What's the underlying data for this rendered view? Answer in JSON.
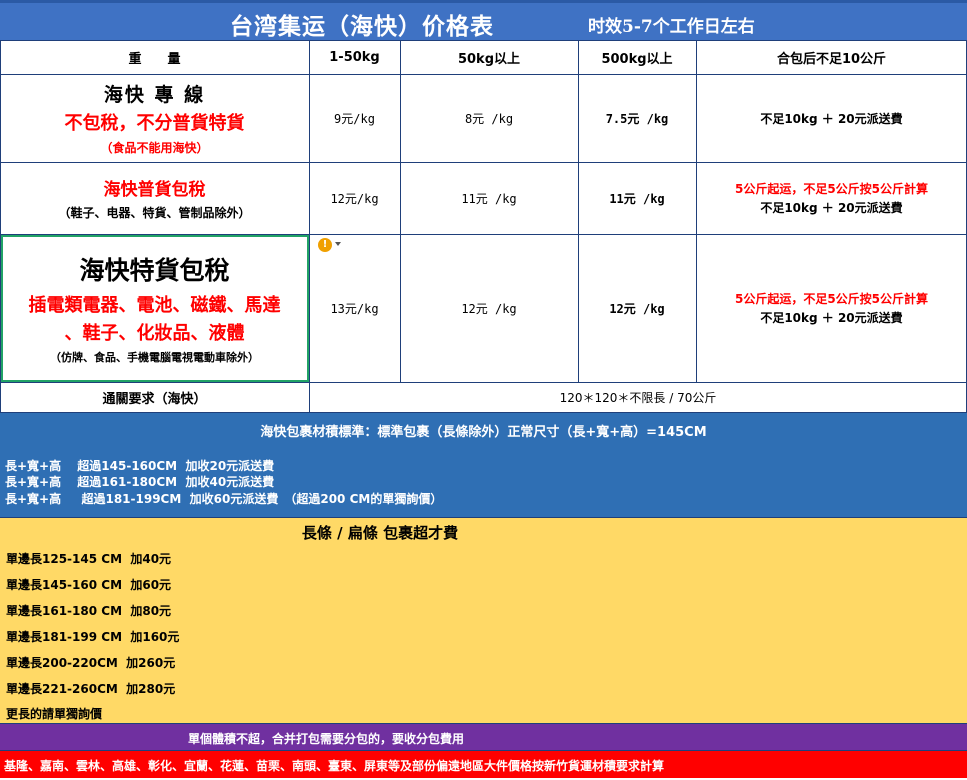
{
  "colors": {
    "title_bar": "#3f72c4",
    "header_bg": "#ffffff",
    "grid_line": "#1f3f7a",
    "blue_section": "#2f6fb4",
    "yellow_section": "#ffd966",
    "purple_bar": "#7030a0",
    "red_bar": "#ff0000",
    "red_text": "#ff0000",
    "selection_border": "#21a366"
  },
  "title": {
    "main": "台湾集运（海快）价格表",
    "subtitle": "时效5-7个工作日左右"
  },
  "table": {
    "headers": [
      "重　　量",
      "1-50kg",
      "50kg以上",
      "500kg以上",
      "合包后不足10公斤"
    ],
    "rows": [
      {
        "name": "海快 專 線",
        "desc_red": "不包稅，不分普貨特貨",
        "note_red": "（食品不能用海快）",
        "p1": "9元/kg",
        "p2": "8元 /kg",
        "p3": "7.5元 /kg",
        "extra_red": "",
        "extra": "不足10kg ＋ 20元派送費"
      },
      {
        "name_red": "海快普貨包稅",
        "note": "（鞋子、电器、特貨、管制品除外）",
        "p1": "12元/kg",
        "p2": "11元 /kg",
        "p3": "11元 /kg",
        "extra_red": "5公斤起运，不足5公斤按5公斤計算",
        "extra": "不足10kg ＋ 20元派送費"
      },
      {
        "name": "海快特貨包稅",
        "desc_red_1": "插電類電器、電池、磁鐵、馬達",
        "desc_red_2": "、鞋子、化妝品、液體",
        "note": "（仿牌、食品、手機電腦電視電動車除外）",
        "p1": "13元/kg",
        "p2": "12元 /kg",
        "p3": "12元 /kg",
        "extra_red": "5公斤起运，不足5公斤按5公斤計算",
        "extra": "不足10kg ＋ 20元派送費"
      }
    ],
    "customs": {
      "label": "通關要求（海快）",
      "value": "120＊120＊不限長 / 70公斤"
    }
  },
  "blue_section": {
    "title": "海快包裹材積標準：標準包裹（長條除外）正常尺寸（長+寬+高）=145CM",
    "lines": [
      "長+寬+高　 超過145-160CM  加收20元派送費",
      "長+寬+高　 超過161-180CM  加收40元派送費",
      "長+寬+高　  超過181-199CM  加收60元派送費　（超過200 CM的單獨詢價）"
    ]
  },
  "yellow_section": {
    "title": "長條 / 扁條 包裹超才費",
    "lines": [
      "單邊長125-145 CM  加40元",
      "單邊長145-160 CM  加60元",
      "單邊長161-180 CM  加80元",
      "單邊長181-199 CM  加160元",
      "單邊長200-220CM  加260元",
      "單邊長221-260CM  加280元",
      "更長的請單獨詢價"
    ]
  },
  "purple_bar": {
    "text": "單個體積不超，合并打包需要分包的，要收分包費用"
  },
  "red_bar": {
    "text": "基隆、嘉南、雲林、高雄、彰化、宜蘭、花蓮、苗栗、南頭、臺東、屏東等及部份偏遠地區大件價格按新竹貨運材積要求計算"
  },
  "icons": {
    "warning": "warning-icon",
    "dropdown": "chevron-down-icon"
  }
}
